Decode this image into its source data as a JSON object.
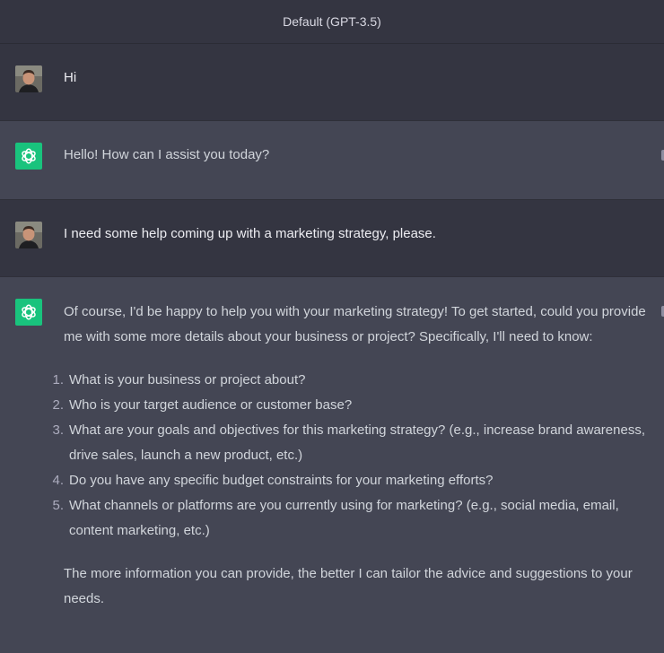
{
  "header": {
    "model_label": "Default (GPT-3.5)"
  },
  "messages": [
    {
      "role": "user",
      "text": "Hi"
    },
    {
      "role": "assistant",
      "text": "Hello! How can I assist you today?"
    },
    {
      "role": "user",
      "text": "I need some help coming up with a marketing strategy, please."
    },
    {
      "role": "assistant",
      "intro": "Of course, I'd be happy to help you with your marketing strategy! To get started, could you provide me with some more details about your business or project? Specifically, I'll need to know:",
      "list": [
        {
          "num": "1.",
          "text": "What is your business or project about?"
        },
        {
          "num": "2.",
          "text": "Who is your target audience or customer base?"
        },
        {
          "num": "3.",
          "text": "What are your goals and objectives for this marketing strategy? (e.g., increase brand awareness, drive sales, launch a new product, etc.)"
        },
        {
          "num": "4.",
          "text": "Do you have any specific budget constraints for your marketing efforts?"
        },
        {
          "num": "5.",
          "text": "What channels or platforms are you currently using for marketing? (e.g., social media, email, content marketing, etc.)"
        }
      ],
      "outro": "The more information you can provide, the better I can tailor the advice and suggestions to your needs."
    }
  ],
  "icons": {
    "user_avatar": "user-avatar-photo",
    "assistant_avatar": "openai-logo-icon"
  },
  "colors": {
    "header_bg": "#343541",
    "user_bg": "#343541",
    "assistant_bg": "#444654",
    "assistant_avatar_bg": "#19c37d",
    "text": "#ececf1"
  }
}
